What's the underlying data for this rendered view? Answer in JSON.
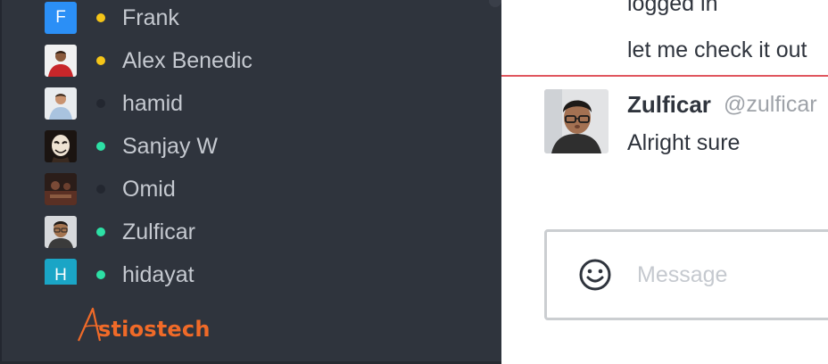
{
  "colors": {
    "sidebar_bg": "#2f343d",
    "status_away": "#f5c518",
    "status_online": "#2de0a5",
    "status_offline": "#232730",
    "unread_divider": "#e0565e",
    "brand": "#f06a28"
  },
  "sidebar": {
    "users": [
      {
        "name": "Frank",
        "status": "away",
        "avatar_letter": "F",
        "avatar_color": "#2b8ff6",
        "avatar_kind": "letter"
      },
      {
        "name": "Alex Benedic",
        "status": "away",
        "avatar_kind": "photo",
        "avatar_icon": "person-red-shirt-photo"
      },
      {
        "name": "hamid",
        "status": "offline",
        "avatar_kind": "photo",
        "avatar_icon": "person-light-shirt-photo"
      },
      {
        "name": "Sanjay W",
        "status": "online",
        "avatar_kind": "photo",
        "avatar_icon": "masked-person-photo"
      },
      {
        "name": "Omid",
        "status": "offline",
        "avatar_kind": "photo",
        "avatar_icon": "dark-room-photo"
      },
      {
        "name": "Zulficar",
        "status": "online",
        "avatar_kind": "photo",
        "avatar_icon": "glasses-person-photo"
      },
      {
        "name": "hidayat",
        "status": "online",
        "avatar_letter": "H",
        "avatar_color": "#1aa5c6",
        "avatar_kind": "letter"
      }
    ],
    "brand": "stiostech"
  },
  "chat": {
    "previous_lines": [
      "logged in",
      "let me check it out"
    ],
    "message": {
      "author": "Zulficar",
      "username": "@zulficar",
      "text": "Alright sure"
    },
    "composer": {
      "placeholder": "Message",
      "emoji_icon": "smiley-face-icon"
    }
  }
}
